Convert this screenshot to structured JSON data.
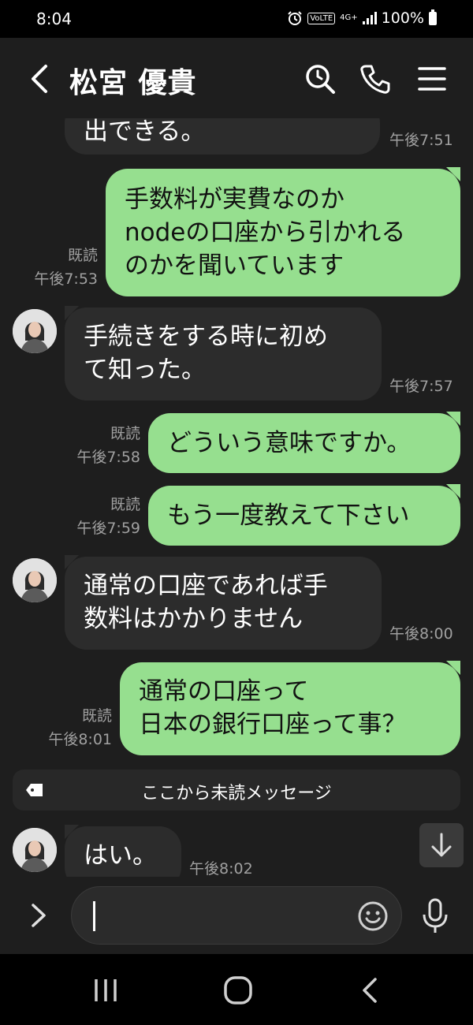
{
  "status": {
    "time": "8:04",
    "volte": "VoLTE",
    "network": "4G+",
    "battery": "100%"
  },
  "header": {
    "title": "松宮 優貴"
  },
  "messages": [
    {
      "side": "received",
      "lines": [
        "出できる。"
      ],
      "time": "午後7:51"
    },
    {
      "side": "sent",
      "lines": [
        "手数料が実費なのか",
        "nodeの口座から引かれる",
        "のかを聞いています"
      ],
      "read": "既読",
      "time": "午後7:53"
    },
    {
      "side": "received",
      "lines": [
        "手続きをする時に初め",
        "て知った。"
      ],
      "time": "午後7:57"
    },
    {
      "side": "sent",
      "lines": [
        "どういう意味ですか。"
      ],
      "read": "既読",
      "time": "午後7:58"
    },
    {
      "side": "sent",
      "lines": [
        "もう一度教えて下さい"
      ],
      "read": "既読",
      "time": "午後7:59"
    },
    {
      "side": "received",
      "lines": [
        "通常の口座であれば手",
        "数料はかかりません"
      ],
      "time": "午後8:00"
    },
    {
      "side": "sent",
      "lines": [
        "通常の口座って",
        "日本の銀行口座って事？"
      ],
      "read": "既読",
      "time": "午後8:01"
    },
    {
      "side": "received",
      "lines": [
        "はい。"
      ],
      "time": "午後8:02"
    }
  ],
  "unread_divider": "ここから未読メッセージ",
  "icons": {
    "back": "chevron-left-icon",
    "search": "search-icon",
    "call": "phone-icon",
    "menu": "hamburger-menu-icon",
    "unread_tag": "tag-icon",
    "scroll": "arrow-down-icon",
    "expand": "chevron-right-icon",
    "emoji": "smiley-icon",
    "mic": "microphone-icon"
  },
  "colors": {
    "sent_bubble": "#96df8f",
    "received_bubble": "#2c2c2c",
    "background": "#1e1e1e"
  }
}
